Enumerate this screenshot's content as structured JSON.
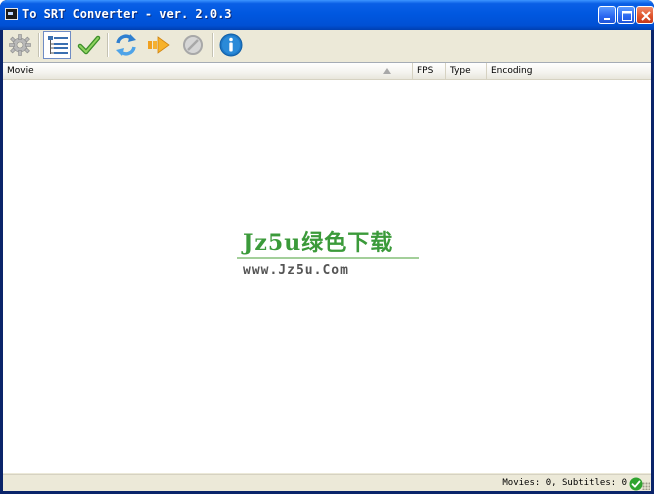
{
  "window": {
    "title": "To SRT Converter - ver. 2.0.3",
    "controls": [
      "minimize-icon",
      "maximize-icon",
      "close-icon"
    ]
  },
  "toolbar": {
    "buttons": [
      {
        "name": "settings",
        "icon": "gear-icon"
      },
      {
        "name": "list-view",
        "icon": "tree-list-icon",
        "active": true
      },
      {
        "name": "check",
        "icon": "checkmark-icon"
      },
      {
        "name": "refresh",
        "icon": "refresh-icon"
      },
      {
        "name": "convert",
        "icon": "arrow-right-icon"
      },
      {
        "name": "stop",
        "icon": "stop-icon",
        "disabled": true
      },
      {
        "name": "about",
        "icon": "info-icon"
      }
    ]
  },
  "list": {
    "columns": [
      "Movie",
      "FPS",
      "Type",
      "Encoding"
    ],
    "sort_column": "Movie",
    "sort_direction": "ascending",
    "rows": []
  },
  "watermark": {
    "logo": "Jz5u绿色下载",
    "url": "www.Jz5u.Com"
  },
  "status": {
    "text": "Movies: 0, Subtitles: 0",
    "icon": "ok-icon"
  },
  "colors": {
    "titlebar": "#0058e0",
    "face": "#ece9d8",
    "watermark_green": "#3b9a3a",
    "ok_green": "#2fa32f"
  }
}
